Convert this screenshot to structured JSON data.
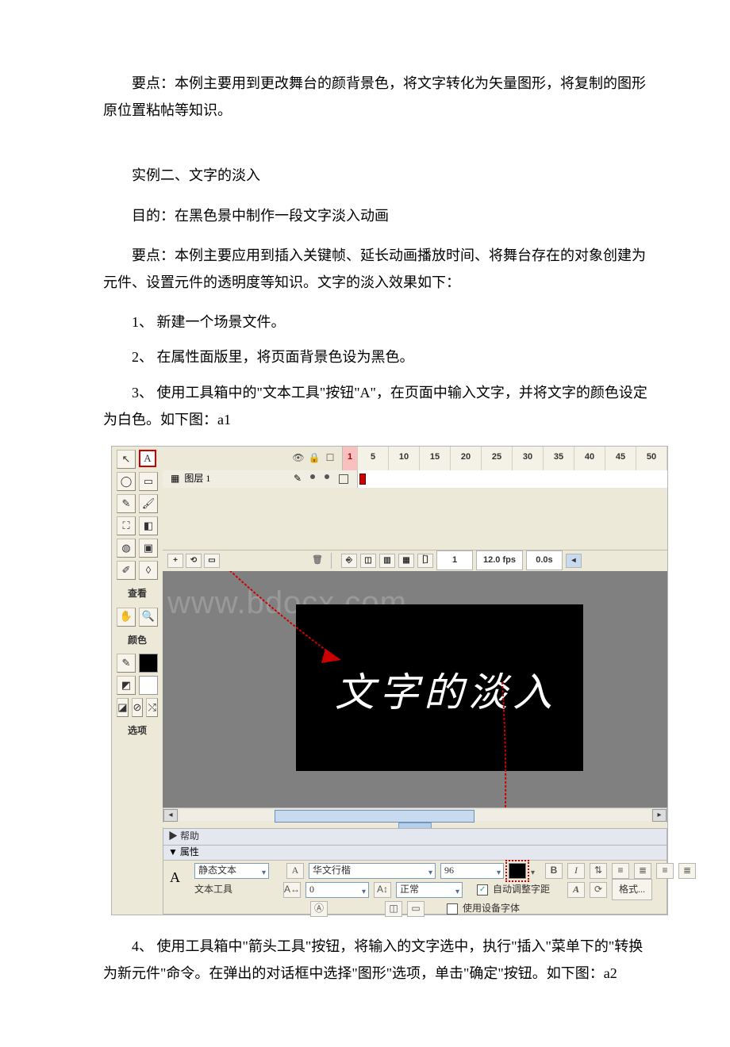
{
  "paragraphs": {
    "p1": "要点：本例主要用到更改舞台的颜背景色，将文字转化为矢量图形，将复制的图形原位置粘帖等知识。",
    "p2": "实例二、文字的淡入",
    "p3": "目的：在黑色景中制作一段文字淡入动画",
    "p4": "要点：本例主要应用到插入关键帧、延长动画播放时间、将舞台存在的对象创建为元件、设置元件的透明度等知识。文字的淡入效果如下：",
    "p5": "1、 新建一个场景文件。",
    "p6": "2、 在属性面版里，将页面背景色设为黑色。",
    "p7": "3、 使用工具箱中的\"文本工具\"按钮\"A\"，在页面中输入文字，并将文字的颜色设定为白色。如下图：a1",
    "p8": "4、 使用工具箱中\"箭头工具\"按钮，将输入的文字选中，执行\"插入\"菜单下的\"转换为新元件\"命令。在弹出的对话框中选择\"图形\"选项，单击\"确定\"按钮。如下图：a2"
  },
  "screenshot": {
    "watermark": "www.bdocx.com",
    "toolbox": {
      "section_view": "查看",
      "section_color": "颜色",
      "section_options": "选项"
    },
    "timeline": {
      "layer_name": "图层 1",
      "ruler": [
        "1",
        "5",
        "10",
        "15",
        "20",
        "25",
        "30",
        "35",
        "40",
        "45",
        "50"
      ],
      "frame_num": "1",
      "fps": "12.0 fps",
      "time": "0.0s"
    },
    "stage_text": "文字的淡入",
    "panel": {
      "help_label": "▶ 帮助",
      "props_label": "▼ 属性",
      "text_type": "静态文本",
      "tool_name": "文本工具",
      "font": "华文行楷",
      "font_size": "96",
      "tracking": "0",
      "kerning_mode": "正常",
      "auto_kern": "自动调整字距",
      "format_btn": "格式...",
      "device_font": "使用设备字体"
    }
  }
}
